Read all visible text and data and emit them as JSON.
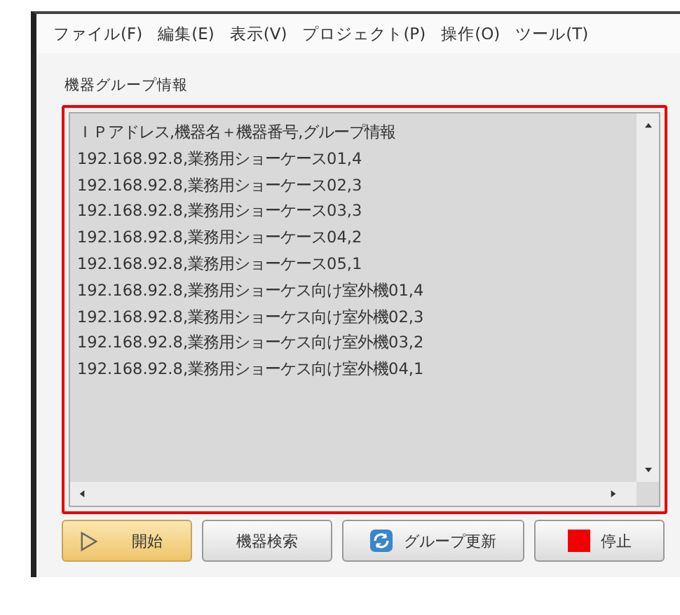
{
  "menu": [
    "ファイル(F)",
    "編集(E)",
    "表示(V)",
    "プロジェクト(P)",
    "操作(O)",
    "ツール(T)"
  ],
  "group_label": "機器グループ情報",
  "text_lines": [
    "ＩＰアドレス,機器名＋機器番号,グループ情報",
    "192.168.92.8,業務用ショーケース01,4",
    "192.168.92.8,業務用ショーケース02,3",
    "192.168.92.8,業務用ショーケース03,3",
    "192.168.92.8,業務用ショーケース04,2",
    "192.168.92.8,業務用ショーケース05,1",
    "192.168.92.8,業務用ショーケス向け室外機01,4",
    "192.168.92.8,業務用ショーケス向け室外機02,3",
    "192.168.92.8,業務用ショーケス向け室外機03,2",
    "192.168.92.8,業務用ショーケス向け室外機04,1"
  ],
  "buttons": [
    {
      "kind": "start",
      "label": "開始",
      "selected": true
    },
    {
      "kind": "plain",
      "label": "機器検索",
      "selected": false
    },
    {
      "kind": "refresh",
      "label": "グループ更新",
      "selected": false
    },
    {
      "kind": "stop",
      "label": "停止",
      "selected": false
    }
  ]
}
